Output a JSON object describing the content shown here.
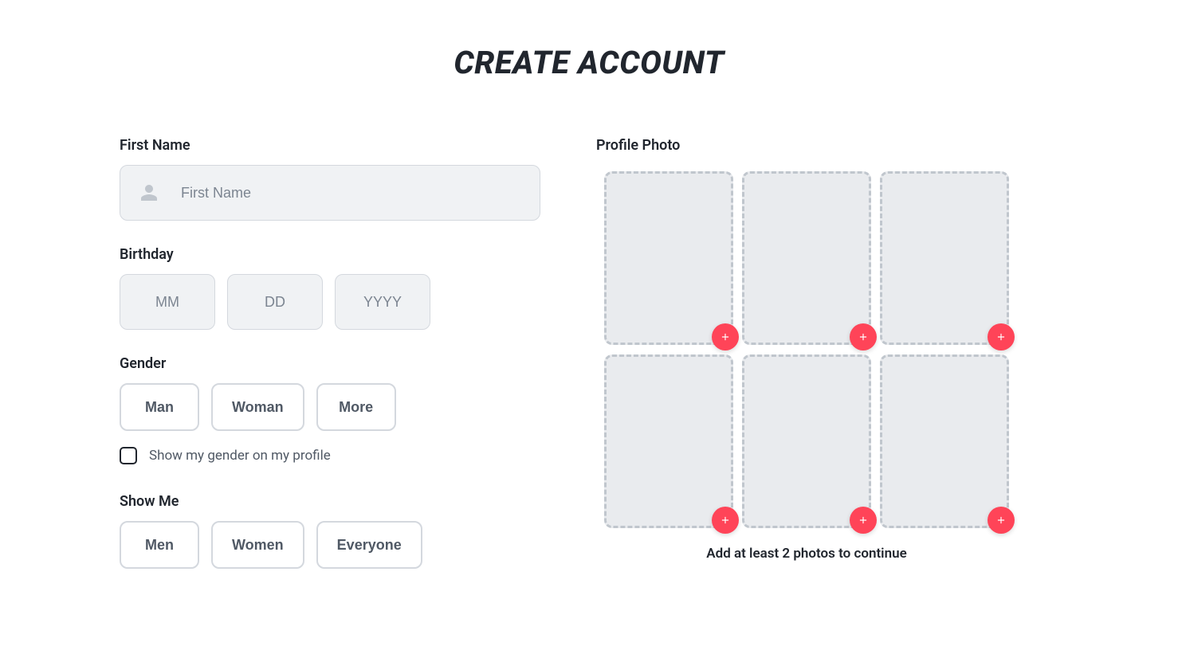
{
  "title": "CREATE ACCOUNT",
  "firstName": {
    "label": "First Name",
    "placeholder": "First Name",
    "value": ""
  },
  "birthday": {
    "label": "Birthday",
    "mm": {
      "placeholder": "MM",
      "value": ""
    },
    "dd": {
      "placeholder": "DD",
      "value": ""
    },
    "yyyy": {
      "placeholder": "YYYY",
      "value": ""
    }
  },
  "gender": {
    "label": "Gender",
    "options": {
      "man": "Man",
      "woman": "Woman",
      "more": "More"
    },
    "showOnProfileLabel": "Show my gender on my profile",
    "showOnProfileChecked": false
  },
  "showMe": {
    "label": "Show Me",
    "options": {
      "men": "Men",
      "women": "Women",
      "everyone": "Everyone"
    }
  },
  "photos": {
    "label": "Profile Photo",
    "slotCount": 6,
    "hint": "Add at least 2 photos to continue"
  },
  "colors": {
    "accent": "#ff4458"
  }
}
